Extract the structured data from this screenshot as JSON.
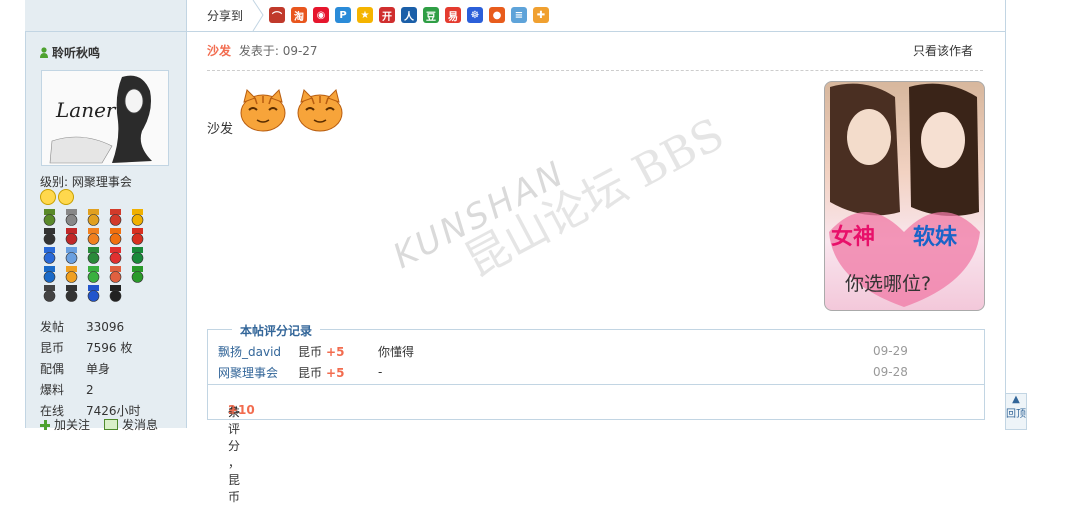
{
  "share": {
    "label": "分享到",
    "icons": [
      {
        "name": "delicious-icon",
        "color": "#c0392b",
        "glyph": "⌒"
      },
      {
        "name": "taobao-icon",
        "color": "#e8561e",
        "glyph": "淘"
      },
      {
        "name": "weibo-icon",
        "color": "#e6162d",
        "glyph": "◉"
      },
      {
        "name": "qzone-icon",
        "color": "#2a8bd8",
        "glyph": "P"
      },
      {
        "name": "qq-zone-star-icon",
        "color": "#f5b400",
        "glyph": "★"
      },
      {
        "name": "kaixin-icon",
        "color": "#d02e2e",
        "glyph": "开"
      },
      {
        "name": "renren-icon",
        "color": "#1b5fa8",
        "glyph": "人"
      },
      {
        "name": "douban-icon",
        "color": "#2f9e45",
        "glyph": "豆"
      },
      {
        "name": "sohu-icon",
        "color": "#e43b2f",
        "glyph": "易"
      },
      {
        "name": "baidu-icon",
        "color": "#2b5fd9",
        "glyph": "☸"
      },
      {
        "name": "apple-icon",
        "color": "#e85c1c",
        "glyph": "●"
      },
      {
        "name": "notes-icon",
        "color": "#5ea3d9",
        "glyph": "≡"
      },
      {
        "name": "bookmark-icon",
        "color": "#f0a030",
        "glyph": "✚"
      }
    ]
  },
  "user": {
    "name": "聆听秋鸣",
    "avatar_text": "Laner",
    "level": "级别: 网聚理事会",
    "stats": [
      {
        "k": "发帖",
        "v": "33096"
      },
      {
        "k": "昆币",
        "v": "7596 枚"
      },
      {
        "k": "配偶",
        "v": "单身"
      },
      {
        "k": "爆料",
        "v": "2"
      },
      {
        "k": "在线",
        "v": "7426小时"
      }
    ],
    "follow_label": "加关注",
    "message_label": "发消息"
  },
  "post": {
    "floor": "沙发",
    "time": "发表于: 09-27",
    "only_author": "只看该作者",
    "content": "沙发",
    "watermark_cn": "昆山论坛",
    "watermark_en": "KUNSHAN",
    "watermark_big": "BBS"
  },
  "ad": {
    "line1a": "女神",
    "line1b": "软妹",
    "line2": "你选哪位?"
  },
  "rating": {
    "legend": "本帖评分记录",
    "rows": [
      {
        "user": "飘扬_david",
        "coin": "昆币",
        "plus": "+5",
        "reason": "你懂得",
        "date": "09-29"
      },
      {
        "user": "网聚理事会",
        "coin": "昆币",
        "plus": "+5",
        "reason": "-",
        "date": "09-28"
      }
    ],
    "foot_prefix": "共",
    "foot_count": "2",
    "foot_mid": "条评分 ，昆币",
    "foot_total": "+10"
  },
  "totop": "回顶"
}
